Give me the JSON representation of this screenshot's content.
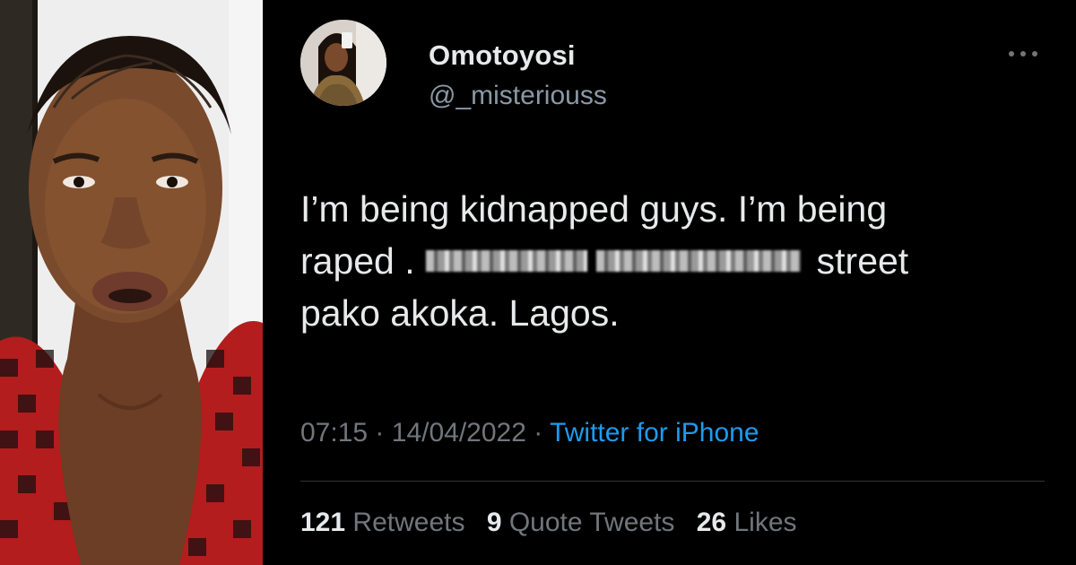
{
  "tweet": {
    "author": {
      "display_name": "Omotoyosi",
      "handle": "@_misteriouss"
    },
    "text_lines": {
      "line1": "I’m being kidnapped guys. I’m being",
      "line2_start": "raped .",
      "line2_end": "street",
      "line3": "pako akoka. Lagos."
    },
    "meta": {
      "time": "07:15",
      "separator": "·",
      "date": "14/04/2022",
      "source": "Twitter for iPhone"
    },
    "stats": {
      "retweets_count": "121",
      "retweets_label": "Retweets",
      "quote_count": "9",
      "quote_label": "Quote Tweets",
      "likes_count": "26",
      "likes_label": "Likes"
    },
    "more_icon": "more-horizontal-icon"
  },
  "colors": {
    "background": "#000000",
    "primary_text": "#e7e9ea",
    "secondary_text": "#71767b",
    "handle_text": "#8b98a5",
    "link": "#1d9bf0",
    "divider": "#2f3336"
  }
}
